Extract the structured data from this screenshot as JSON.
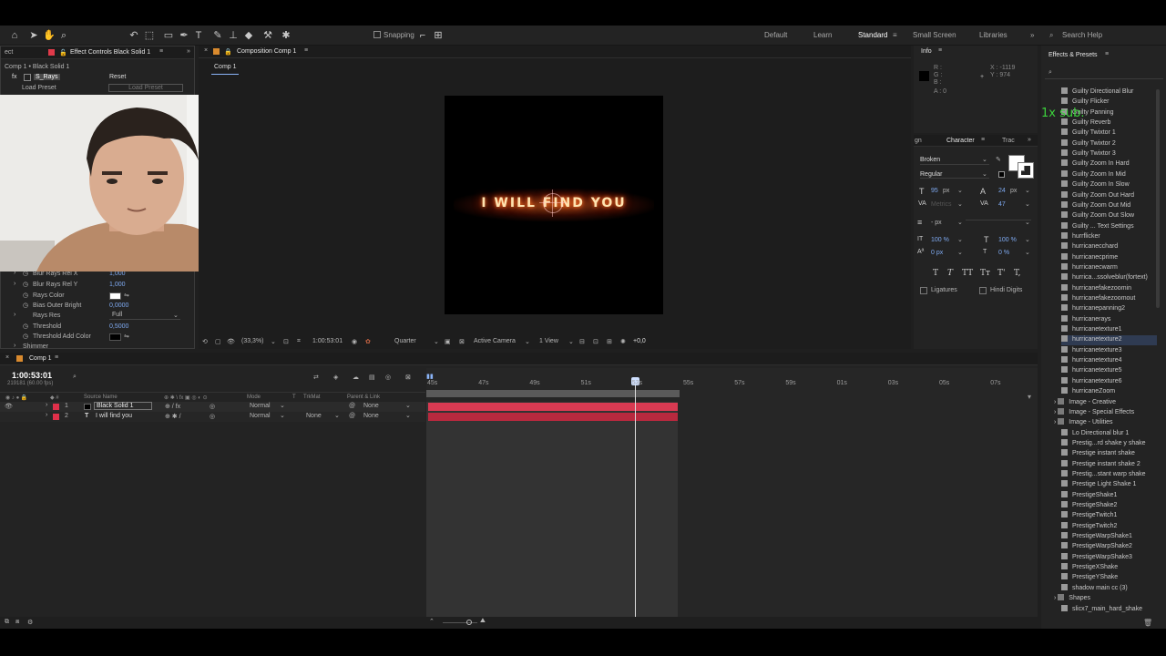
{
  "toolbar": {
    "snapping": "Snapping",
    "workspaces": [
      "Default",
      "Learn",
      "Standard",
      "Small Screen",
      "Libraries"
    ],
    "search": "Search Help"
  },
  "effect_controls": {
    "tab_title": "Effect Controls Black Solid 1",
    "breadcrumb": "Comp 1 • Black Solid 1",
    "fx_name": "S_Rays",
    "reset": "Reset",
    "load_preset_label": "Load Preset",
    "load_preset_button": "Load Preset",
    "params": [
      {
        "name": "Blur Rays Rel X",
        "value": "1,000"
      },
      {
        "name": "Blur Rays Rel Y",
        "value": "1,000"
      },
      {
        "name": "Rays Color",
        "value": ""
      },
      {
        "name": "Bias Outer Bright",
        "value": "0,0000"
      },
      {
        "name": "Rays Res",
        "value": "Full"
      },
      {
        "name": "Threshold",
        "value": "0,5000"
      },
      {
        "name": "Threshold Add Color",
        "value": ""
      },
      {
        "name": "Shimmer",
        "value": ""
      }
    ]
  },
  "composition": {
    "tab_title": "Composition Comp 1",
    "sub_tab": "Comp 1",
    "canvas_text": "I WILL FIND YOU",
    "zoom": "(33,3%)",
    "timecode": "1:00:53:01",
    "quality": "Quarter",
    "camera": "Active Camera",
    "view": "1 View",
    "exposure": "+0,0"
  },
  "info": {
    "title": "Info",
    "r": "R :",
    "g": "G :",
    "b": "B :",
    "a": "A : 0",
    "x": "X : -1119",
    "y": "Y : 974"
  },
  "character": {
    "left_tab": "gn",
    "title": "Character",
    "right_tab": "Trac",
    "font": "Broken",
    "style": "Regular",
    "size": "95",
    "size_unit": "px",
    "leading": "24",
    "leading_unit": "px",
    "tracking": "47",
    "kerning": "Metrics",
    "stroke_width": "- px",
    "vscale": "100 %",
    "hscale": "100 %",
    "baseline": "0 px",
    "tsume": "0 %",
    "ligatures": "Ligatures",
    "hindi": "Hindi Digits",
    "styles": [
      "T",
      "T",
      "TT",
      "Tт",
      "T'",
      "T,"
    ]
  },
  "effects_presets": {
    "title": "Effects & Presets",
    "badge": "1x sub.",
    "items": [
      {
        "label": "Guilty Directional Blur",
        "sel": false
      },
      {
        "label": "Guilty Flicker",
        "sel": false
      },
      {
        "label": "Guilty Panning",
        "sel": false
      },
      {
        "label": "Guilty Reverb",
        "sel": false
      },
      {
        "label": "Guilty Twixtor 1",
        "sel": false
      },
      {
        "label": "Guilty Twixtor 2",
        "sel": false
      },
      {
        "label": "Guilty Twixtor 3",
        "sel": false
      },
      {
        "label": "Guilty Zoom In Hard",
        "sel": false
      },
      {
        "label": "Guilty Zoom In Mid",
        "sel": false
      },
      {
        "label": "Guilty Zoom In Slow",
        "sel": false
      },
      {
        "label": "Guilty Zoom Out Hard",
        "sel": false
      },
      {
        "label": "Guilty Zoom Out Mid",
        "sel": false
      },
      {
        "label": "Guilty Zoom Out Slow",
        "sel": false
      },
      {
        "label": "Guilty ... Text Settings",
        "sel": false
      },
      {
        "label": "hurrflicker",
        "sel": false
      },
      {
        "label": "hurricanecchard",
        "sel": false
      },
      {
        "label": "hurricanecprime",
        "sel": false
      },
      {
        "label": "hurricanecwarm",
        "sel": false
      },
      {
        "label": "hurrica...ssolveblur(fortext)",
        "sel": false
      },
      {
        "label": "hurricanefakezoomin",
        "sel": false
      },
      {
        "label": "hurricanefakezoomout",
        "sel": false
      },
      {
        "label": "hurricanepanning2",
        "sel": false
      },
      {
        "label": "hurricanerays",
        "sel": false
      },
      {
        "label": "hurricanetexture1",
        "sel": false
      },
      {
        "label": "hurricanetexture2",
        "sel": true
      },
      {
        "label": "hurricanetexture3",
        "sel": false
      },
      {
        "label": "hurricanetexture4",
        "sel": false
      },
      {
        "label": "hurricanetexture5",
        "sel": false
      },
      {
        "label": "hurricanetexture6",
        "sel": false
      },
      {
        "label": "hurricaneZoom",
        "sel": false
      },
      {
        "label": "Image - Creative",
        "sel": false,
        "folder": true
      },
      {
        "label": "Image - Special Effects",
        "sel": false,
        "folder": true
      },
      {
        "label": "Image - Utilities",
        "sel": false,
        "folder": true
      },
      {
        "label": "Lo Directional blur 1",
        "sel": false
      },
      {
        "label": "Prestig...rd shake y shake",
        "sel": false
      },
      {
        "label": "Prestige instant shake",
        "sel": false
      },
      {
        "label": "Prestige instant shake 2",
        "sel": false
      },
      {
        "label": "Prestig...stant warp shake",
        "sel": false
      },
      {
        "label": "Prestige Light Shake 1",
        "sel": false
      },
      {
        "label": "PrestigeShake1",
        "sel": false
      },
      {
        "label": "PrestigeShake2",
        "sel": false
      },
      {
        "label": "PrestigeTwitch1",
        "sel": false
      },
      {
        "label": "PrestigeTwitch2",
        "sel": false
      },
      {
        "label": "PrestigeWarpShake1",
        "sel": false
      },
      {
        "label": "PrestigeWarpShake2",
        "sel": false
      },
      {
        "label": "PrestigeWarpShake3",
        "sel": false
      },
      {
        "label": "PrestigeXShake",
        "sel": false
      },
      {
        "label": "PrestigeYShake",
        "sel": false
      },
      {
        "label": "shadow main cc (3)",
        "sel": false
      },
      {
        "label": "Shapes",
        "sel": false,
        "folder": true
      },
      {
        "label": "slicx7_main_hard_shake",
        "sel": false
      }
    ]
  },
  "timeline": {
    "tab": "Comp 1",
    "timecode": "1:00:53:01",
    "frame_info": "219181 (60.00 fps)",
    "headers": {
      "source": "Source Name",
      "mode": "Mode",
      "t": "T",
      "trkmat": "TrkMat",
      "parent": "Parent & Link"
    },
    "layers": [
      {
        "num": "1",
        "name": "Black Solid 1",
        "mode": "Normal",
        "trkmat": "",
        "parent": "None"
      },
      {
        "num": "2",
        "name": "I will find you",
        "mode": "Normal",
        "trkmat": "None",
        "parent": "None"
      }
    ],
    "ruler": [
      "45s",
      "47s",
      "49s",
      "51s",
      "53s",
      "55s",
      "57s",
      "59s",
      "01s",
      "03s",
      "05s",
      "07s"
    ]
  },
  "colors": {
    "accent": "#4a8cf7",
    "layer_red": "#e0304a",
    "selected": "#2f3b52"
  }
}
